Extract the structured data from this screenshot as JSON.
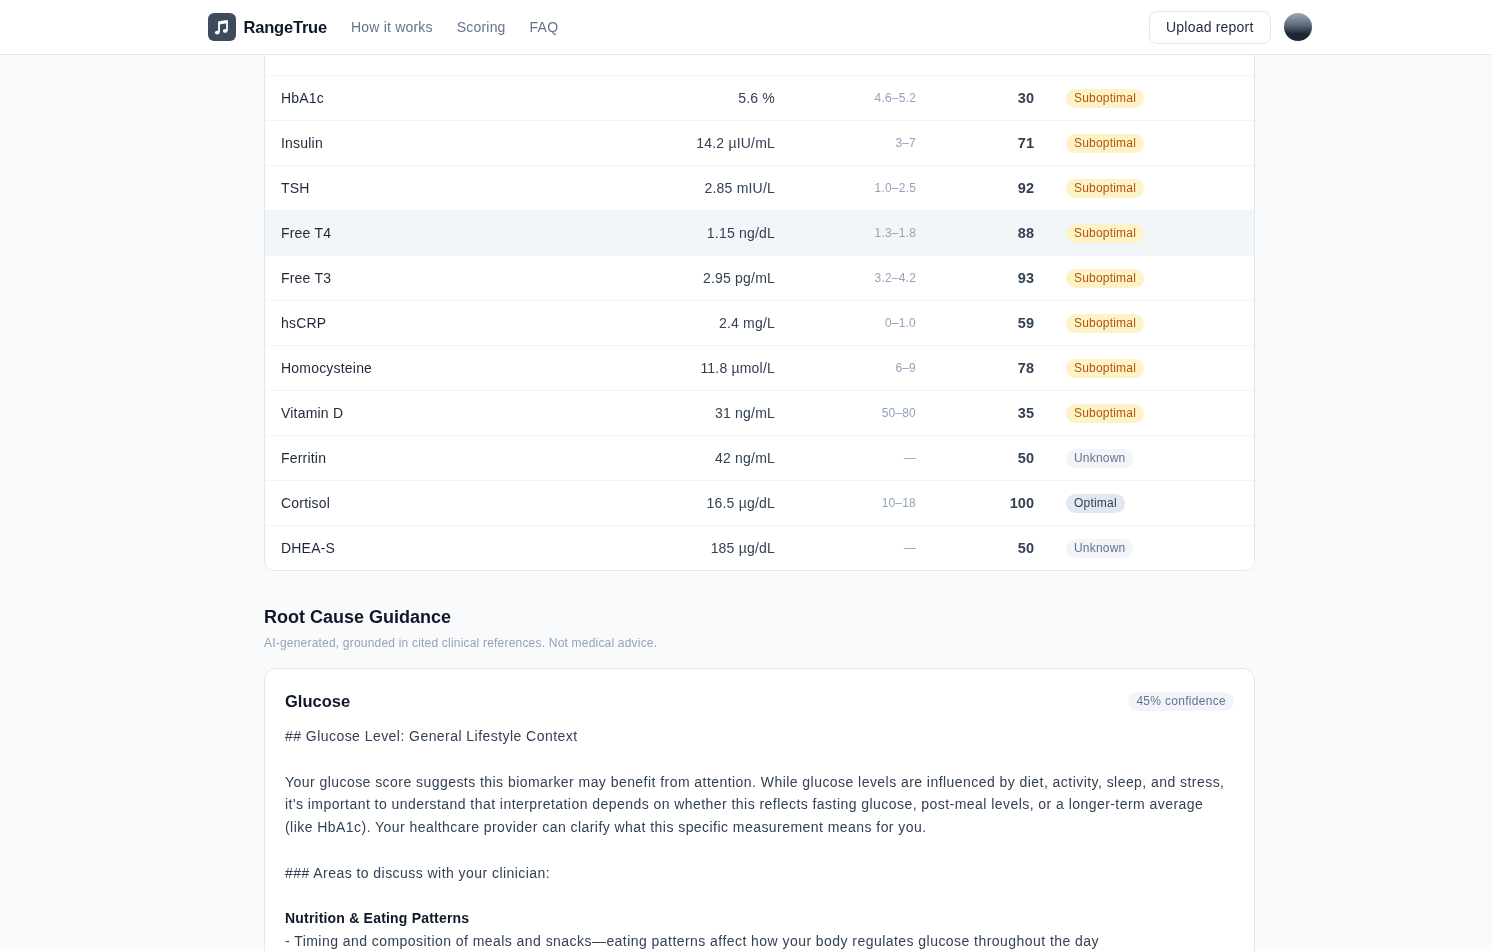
{
  "header": {
    "brand": "RangeTrue",
    "nav": [
      "How it works",
      "Scoring",
      "FAQ"
    ],
    "upload_button": "Upload report"
  },
  "biomarkers_table": {
    "rows": [
      {
        "name": "HbA1c",
        "value": "5.6 %",
        "range": "4.6–5.2",
        "score": "30",
        "status": {
          "text": "Suboptimal",
          "kind": "suboptimal"
        },
        "hovered": false
      },
      {
        "name": "Insulin",
        "value": "14.2 µIU/mL",
        "range": "3–7",
        "score": "71",
        "status": {
          "text": "Suboptimal",
          "kind": "suboptimal"
        },
        "hovered": false
      },
      {
        "name": "TSH",
        "value": "2.85 mIU/L",
        "range": "1.0–2.5",
        "score": "92",
        "status": {
          "text": "Suboptimal",
          "kind": "suboptimal"
        },
        "hovered": false
      },
      {
        "name": "Free T4",
        "value": "1.15 ng/dL",
        "range": "1.3–1.8",
        "score": "88",
        "status": {
          "text": "Suboptimal",
          "kind": "suboptimal"
        },
        "hovered": true
      },
      {
        "name": "Free T3",
        "value": "2.95 pg/mL",
        "range": "3.2–4.2",
        "score": "93",
        "status": {
          "text": "Suboptimal",
          "kind": "suboptimal"
        },
        "hovered": false
      },
      {
        "name": "hsCRP",
        "value": "2.4 mg/L",
        "range": "0–1.0",
        "score": "59",
        "status": {
          "text": "Suboptimal",
          "kind": "suboptimal"
        },
        "hovered": false
      },
      {
        "name": "Homocysteine",
        "value": "11.8 µmol/L",
        "range": "6–9",
        "score": "78",
        "status": {
          "text": "Suboptimal",
          "kind": "suboptimal"
        },
        "hovered": false
      },
      {
        "name": "Vitamin D",
        "value": "31 ng/mL",
        "range": "50–80",
        "score": "35",
        "status": {
          "text": "Suboptimal",
          "kind": "suboptimal"
        },
        "hovered": false
      },
      {
        "name": "Ferritin",
        "value": "42 ng/mL",
        "range": "—",
        "score": "50",
        "status": {
          "text": "Unknown",
          "kind": "unknown"
        },
        "hovered": false
      },
      {
        "name": "Cortisol",
        "value": "16.5 µg/dL",
        "range": "10–18",
        "score": "100",
        "status": {
          "text": "Optimal",
          "kind": "optimal"
        },
        "hovered": false
      },
      {
        "name": "DHEA-S",
        "value": "185 µg/dL",
        "range": "—",
        "score": "50",
        "status": {
          "text": "Unknown",
          "kind": "unknown"
        },
        "hovered": false
      }
    ]
  },
  "root_cause": {
    "title": "Root Cause Guidance",
    "subtitle": "AI-generated, grounded in cited clinical references. Not medical advice.",
    "cards": [
      {
        "title": "Glucose",
        "confidence": "45% confidence",
        "blocks": [
          {
            "kind": "text",
            "text": "## Glucose Level: General Lifestyle Context"
          },
          {
            "kind": "text",
            "text": "Your glucose score suggests this biomarker may benefit from attention. While glucose levels are influenced by diet, activity, sleep, and stress, it's important to understand that interpretation depends on whether this reflects fasting glucose, post-meal levels, or a longer-term average (like HbA1c). Your healthcare provider can clarify what this specific measurement means for you."
          },
          {
            "kind": "text",
            "text": "### Areas to discuss with your clinician:"
          },
          {
            "kind": "subheading",
            "text": "Nutrition & Eating Patterns"
          },
          {
            "kind": "text",
            "text": "- Timing and composition of meals and snacks—eating patterns affect how your body regulates glucose throughout the day"
          }
        ]
      }
    ]
  }
}
